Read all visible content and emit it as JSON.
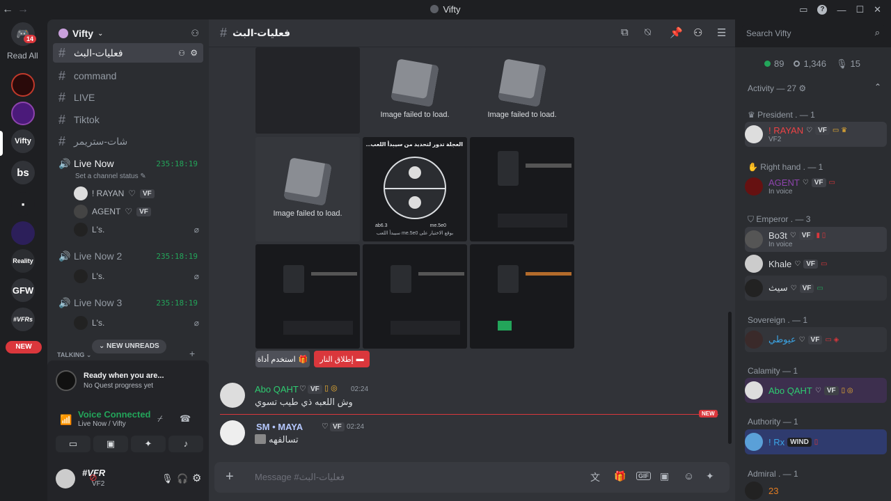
{
  "window": {
    "title": "Vifty"
  },
  "rail": {
    "read_all": "Read All",
    "badge": "14",
    "new_label": "NEW",
    "servers": [
      "Vifty",
      "bs",
      "GFW",
      "#VFRs",
      "Reality"
    ]
  },
  "server": {
    "name": "Vifty"
  },
  "channels": [
    {
      "name": "فعليات-البث",
      "active": true
    },
    {
      "name": "command"
    },
    {
      "name": "LIVE"
    },
    {
      "name": "Tiktok"
    },
    {
      "name": "شات-ستريمر"
    }
  ],
  "voice": [
    {
      "name": "Live Now",
      "time": "235:18:19",
      "status": "Set a channel status",
      "users": [
        {
          "name": "! RAYAN",
          "tag": "VF"
        },
        {
          "name": "AGENT",
          "tag": "VF"
        },
        {
          "name": "L's."
        }
      ]
    },
    {
      "name": "Live Now 2",
      "time": "235:18:19",
      "users": [
        {
          "name": "L's."
        }
      ]
    },
    {
      "name": "Live Now 3",
      "time": "235:18:19",
      "users": [
        {
          "name": "L's."
        }
      ]
    }
  ],
  "new_unreads": "NEW UNREADS",
  "talking": "TALKING",
  "quest": {
    "title": "Ready when you are...",
    "sub": "No Quest progress yet"
  },
  "voice_panel": {
    "status": "Voice Connected",
    "where": "Live Now / Vifty"
  },
  "self": {
    "name": "#VFR",
    "sub": "VF2"
  },
  "chat": {
    "channel": "فعليات-البث",
    "search_placeholder": "Search Vifty",
    "fail_text": "Image failed to load.",
    "shot_title": "...العجلة تدور لتحديد من سيبدأ اللعب",
    "shot_left": "ab6.3",
    "shot_right": "me.5e0",
    "shot_footer": "سيبدأ اللعب me.5e0 بوقع الاختيار على",
    "buttons": [
      {
        "label": "استخدم أداة",
        "style": "grey"
      },
      {
        "label": "إطلاق النار",
        "style": "red"
      }
    ],
    "messages": [
      {
        "author": "Abo QAHT",
        "tag": "VF",
        "time": "02:24",
        "text": "وش اللعبه ذي طيب تسوي"
      },
      {
        "author": "SM • MAYA",
        "tag": "VF",
        "time": "02:24",
        "text": "تسالفهه"
      }
    ],
    "new_label": "NEW",
    "input_placeholder": "Message #فعليات-البث"
  },
  "members": {
    "stats": {
      "online": "89",
      "members": "1,346",
      "voice": "15"
    },
    "activity": "Activity — 27",
    "groups": [
      {
        "role": "President . — 1",
        "members": [
          {
            "name": "! RAYAN",
            "sub": "VF2",
            "tag": "VF",
            "color": "#ed4245"
          }
        ]
      },
      {
        "role": "Right hand . — 1",
        "members": [
          {
            "name": "AGENT",
            "sub": "In voice",
            "tag": "VF",
            "color": "#8e44ad"
          }
        ]
      },
      {
        "role": "Emperor . — 3",
        "members": [
          {
            "name": "Bo3t",
            "sub": "In voice",
            "tag": "VF",
            "color": "#dbdee1"
          },
          {
            "name": "Khale",
            "tag": "VF",
            "color": "#dbdee1"
          },
          {
            "name": "سيث",
            "tag": "VF",
            "color": "#dbdee1"
          }
        ]
      },
      {
        "role": "Sovereign . — 1",
        "members": [
          {
            "name": "عيوطي",
            "tag": "VF",
            "color": "#3ba5e6"
          }
        ]
      },
      {
        "role": "Calamity — 1",
        "members": [
          {
            "name": "Abo QAHT",
            "tag": "VF",
            "color": "#2ecc71"
          }
        ]
      },
      {
        "role": "Authority — 1",
        "members": [
          {
            "name": "! Rx",
            "tag": "WIND",
            "color": "#3ba5e6"
          }
        ]
      },
      {
        "role": "Admiral . — 1",
        "members": [
          {
            "name": "23",
            "color": "#e67e22"
          }
        ]
      }
    ]
  },
  "colors": {
    "accent": "#5865f2",
    "green": "#23a55a",
    "red": "#da373c"
  }
}
